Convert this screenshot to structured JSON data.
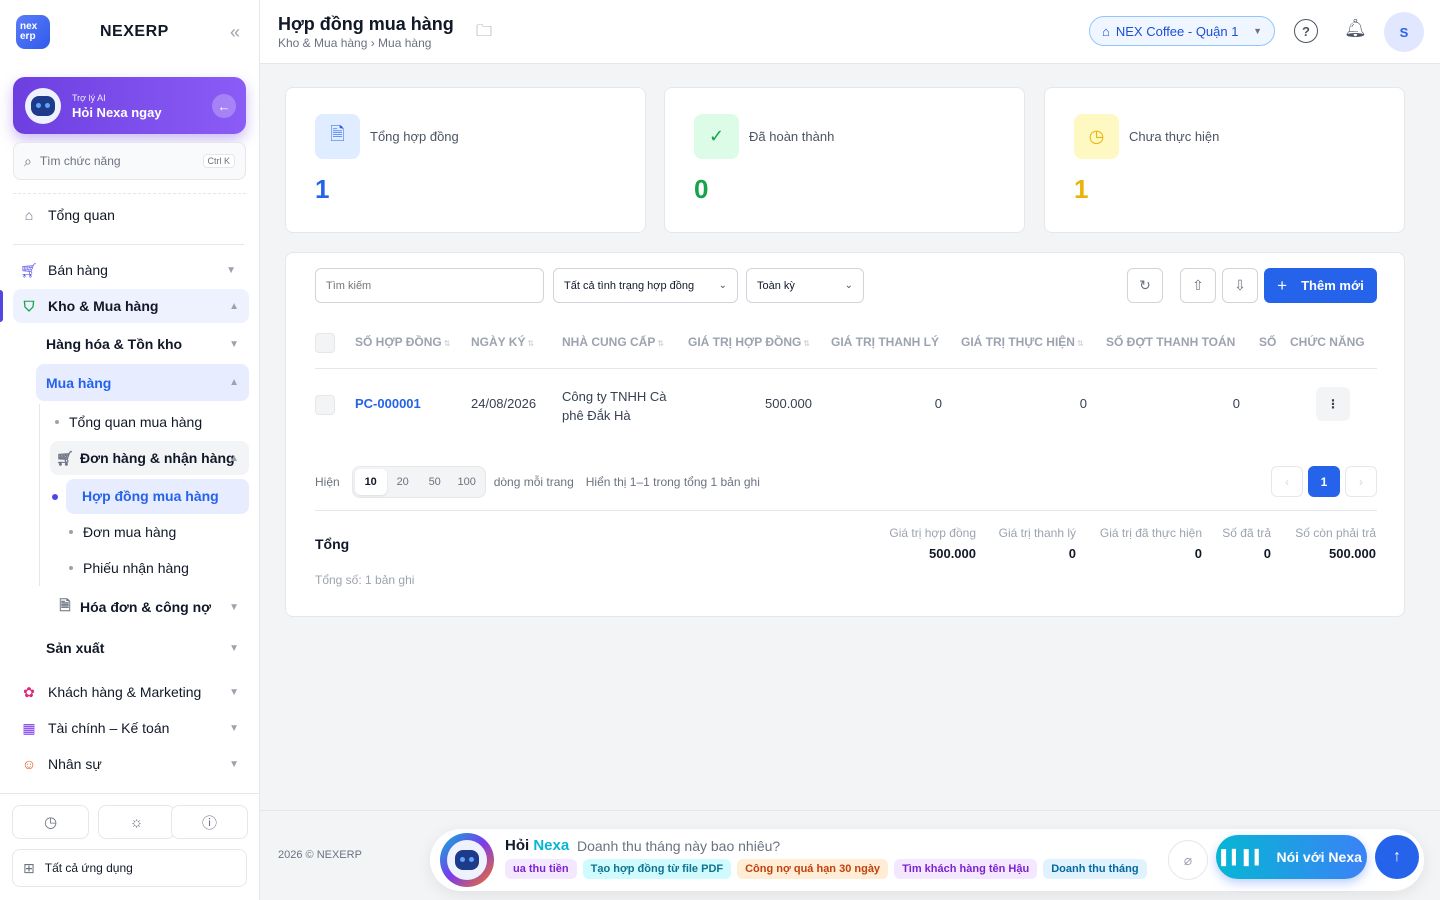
{
  "app": {
    "brand": "NEXERP",
    "logo_top": "nex",
    "logo_bottom": "erp"
  },
  "ai_card": {
    "subtitle": "Trợ lý AI",
    "title": "Hỏi Nexa ngay"
  },
  "side_search": {
    "placeholder": "Tìm chức năng",
    "shortcut": "Ctrl K"
  },
  "sidebar": {
    "overview": "Tổng quan",
    "sales": "Bán hàng",
    "warehouse": "Kho & Mua hàng",
    "goods": "Hàng hóa & Tồn kho",
    "purchasing": "Mua hàng",
    "purchase_overview": "Tổng quan mua hàng",
    "orders_receiving": "Đơn hàng & nhận hàng",
    "contracts": "Hợp đồng mua hàng",
    "purchase_orders": "Đơn mua hàng",
    "receipts": "Phiếu nhận hàng",
    "invoices": "Hóa đơn & công nợ",
    "production": "Sản xuất",
    "crm": "Khách hàng & Marketing",
    "finance": "Tài chính – Kế toán",
    "hr": "Nhân sự",
    "all_apps": "Tất cả ứng dụng"
  },
  "header": {
    "title": "Hợp đồng mua hàng",
    "breadcrumb": "Kho & Mua hàng › Mua hàng",
    "branch": "NEX Coffee - Quận 1",
    "avatar": "S"
  },
  "stats": [
    {
      "label": "Tổng hợp đồng",
      "value": "1",
      "color": "#2563eb"
    },
    {
      "label": "Đã hoàn thành",
      "value": "0",
      "color": "#16a34a"
    },
    {
      "label": "Chưa thực hiện",
      "value": "1",
      "color": "#eab308"
    }
  ],
  "toolbar": {
    "search_placeholder": "Tìm kiếm",
    "status_filter": "Tất cả tình trạng hợp đồng",
    "period_filter": "Toàn kỳ",
    "add_label": "Thêm mới"
  },
  "table": {
    "columns": [
      "SỐ HỢP ĐỒNG",
      "NGÀY KÝ",
      "NHÀ CUNG CẤP",
      "GIÁ TRỊ HỢP ĐỒNG",
      "GIÁ TRỊ THANH LÝ",
      "GIÁ TRỊ THỰC HIỆN",
      "SỐ ĐỢT THANH TOÁN",
      "SỐ",
      "CHỨC NĂNG"
    ],
    "rows": [
      {
        "code": "PC-000001",
        "date": "24/08/2026",
        "supplier": "Công ty TNHH Cà phê Đắk Hà",
        "contract_value": "500.000",
        "liquidation": "0",
        "executed": "0",
        "payments": "0"
      }
    ]
  },
  "pagination": {
    "show": "Hiện",
    "sizes": [
      "10",
      "20",
      "50",
      "100"
    ],
    "per_page": "dòng mỗi trang",
    "summary": "Hiển thị 1–1 trong tổng 1 bản ghi",
    "current": "1"
  },
  "summary": {
    "title": "Tổng",
    "count": "Tổng số: 1 bản ghi",
    "cols": [
      {
        "label": "Giá trị hợp đồng",
        "value": "500.000"
      },
      {
        "label": "Giá trị thanh lý",
        "value": "0"
      },
      {
        "label": "Giá trị đã thực hiện",
        "value": "0"
      },
      {
        "label": "Số đã trả",
        "value": "0"
      },
      {
        "label": "Số còn phải trả",
        "value": "500.000"
      }
    ]
  },
  "footer": {
    "copyright": "2026 © NEXERP",
    "ask_prefix": "Hỏi",
    "ask_name": "Nexa",
    "ask_question": "Doanh thu tháng này bao nhiêu?",
    "chips": [
      "ua thu tiền",
      "Tạo hợp đồng từ file PDF",
      "Công nợ quá hạn 30 ngày",
      "Tìm khách hàng tên Hậu",
      "Doanh thu tháng"
    ],
    "voice": "Nói với Nexa"
  }
}
